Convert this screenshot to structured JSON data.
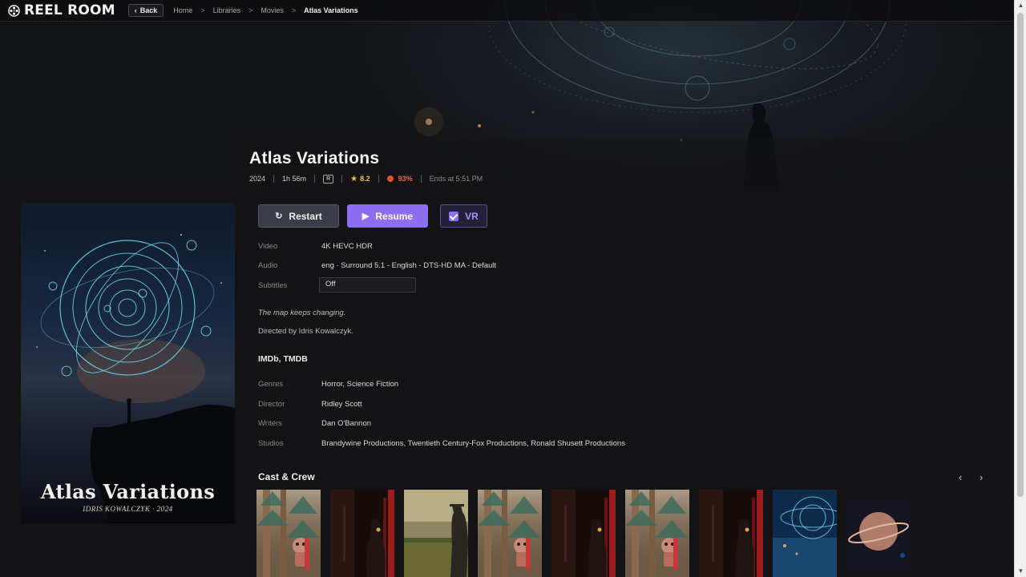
{
  "header": {
    "logo_text": "REEL ROOM",
    "back_label": "Back",
    "breadcrumbs": [
      "Home",
      "Libraries",
      "Movies",
      "Atlas Variations"
    ],
    "separator": ">"
  },
  "movie": {
    "title": "Atlas Variations",
    "year": "2024",
    "runtime": "1h 56m",
    "official_rating": "R",
    "community_rating": "8.2",
    "critic_rating": "93%",
    "ends_at": "Ends at 5:51 PM"
  },
  "poster": {
    "title": "Atlas Variations",
    "subtitle": "IDRIS KOWALCZYK · 2024"
  },
  "actions": {
    "restart_label": "Restart",
    "resume_label": "Resume",
    "vr_label": "VR"
  },
  "streams": {
    "video_label": "Video",
    "video_value": "4K HEVC HDR",
    "audio_label": "Audio",
    "audio_value": "eng · Surround 5.1 - English - DTS-HD MA - Default",
    "subtitles_label": "Subtitles",
    "subtitles_value": "Off"
  },
  "overview": {
    "tagline": "The map keeps changing.",
    "directed_by": "Directed by Idris Kowalczyk."
  },
  "external_links": {
    "imdb": "IMDb",
    "separator": ", ",
    "tmdb": "TMDB"
  },
  "details": {
    "genres_label": "Genres",
    "genres_value": "Horror, Science Fiction",
    "director_label": "Director",
    "director_value": "Ridley Scott",
    "writers_label": "Writers",
    "writers_value": "Dan O'Bannon",
    "studios_label": "Studios",
    "studios_value": "Brandywine Productions, Twentieth Century-Fox Productions, Ronald Shusett Productions"
  },
  "cast": {
    "section_title": "Cast & Crew",
    "prev_icon": "‹",
    "next_icon": "›",
    "cards": [
      {
        "art": "forest"
      },
      {
        "art": "red-curtain"
      },
      {
        "art": "field"
      },
      {
        "art": "forest"
      },
      {
        "art": "red-curtain"
      },
      {
        "art": "forest"
      },
      {
        "art": "red-curtain"
      },
      {
        "art": "orbit"
      },
      {
        "art": "planet"
      }
    ]
  },
  "colors": {
    "accent": "#8b6ff0",
    "star": "#f2c744",
    "critic": "#e96b43",
    "background": "#131316"
  }
}
